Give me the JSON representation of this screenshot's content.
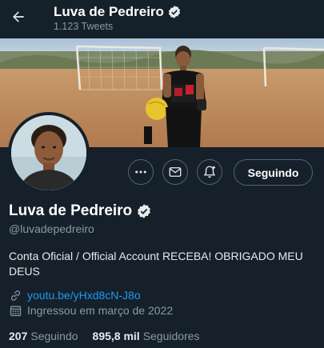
{
  "header": {
    "name": "Luva de Pedreiro",
    "tweet_count": "1.123 Tweets"
  },
  "profile": {
    "name": "Luva de Pedreiro",
    "handle": "@luvadepedreiro",
    "bio": "Conta Oficial / Official Account RECEBA! OBRIGADO MEU DEUS",
    "link": "youtu.be/yHxd8cN-J8o",
    "joined": "Ingressou em março de 2022",
    "verified": true
  },
  "actions": {
    "more_icon": "more-icon",
    "message_icon": "message-icon",
    "notify_icon": "notification-bell-icon",
    "follow_label": "Seguindo"
  },
  "stats": {
    "following_count": "207",
    "following_label": "Seguindo",
    "followers_count": "895,8 mil",
    "followers_label": "Seguidores"
  },
  "colors": {
    "background": "#15202b",
    "accent": "#1d9bf0",
    "muted": "#8b98a5"
  }
}
